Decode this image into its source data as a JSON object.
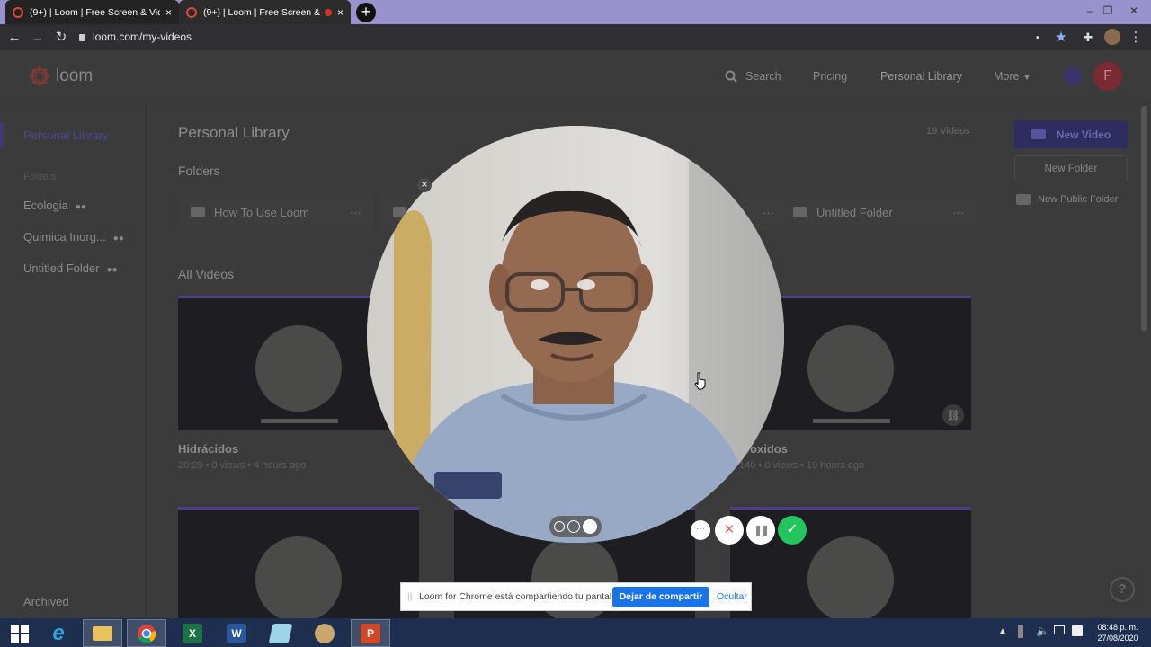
{
  "browser": {
    "tabs": [
      {
        "title": "(9+) | Loom | Free Screen & Vide",
        "close": "×"
      },
      {
        "title": "(9+) | Loom | Free Screen & \\",
        "close": "×"
      }
    ],
    "new_tab": "+",
    "url": "loom.com/my-videos",
    "window_controls": {
      "minimize": "–",
      "restore": "❐",
      "close": "✕"
    }
  },
  "app": {
    "logo_text": "loom",
    "nav": {
      "search": "Search",
      "pricing": "Pricing",
      "personal_library": "Personal Library",
      "more": "More",
      "avatar_letter": "F"
    },
    "sidebar": {
      "active": "Personal Library",
      "folders_heading": "Folders",
      "items": [
        {
          "label": "Ecologia"
        },
        {
          "label": "Quimica Inorg..."
        },
        {
          "label": "Untitled Folder"
        }
      ],
      "archived": "Archived"
    },
    "main": {
      "title": "Personal Library",
      "video_count": "19 Videos",
      "folders_heading": "Folders",
      "folders": [
        {
          "name": "How To Use Loom",
          "menu": "···"
        },
        {
          "name": "Untitled Folder",
          "menu": "···"
        }
      ],
      "all_videos_heading": "All Videos",
      "videos": [
        {
          "title": "Hidrácidos",
          "meta": "20:29 • 0 views • 4 hours ago"
        },
        {
          "title": "roxidos",
          "meta": "140 • 0 views • 19 hours ago"
        }
      ]
    },
    "actions": {
      "new_video": "New Video",
      "new_folder": "New Folder",
      "new_public_folder": "New Public Folder"
    },
    "help": "?"
  },
  "recorder": {
    "close": "×",
    "more": "···",
    "cancel": "✕",
    "pause": "❚❚",
    "done": "✓"
  },
  "share_banner": {
    "handle": "||",
    "message": "Loom for Chrome está compartiendo tu pantalla.",
    "stop_button": "Dejar de compartir",
    "hide_link": "Ocultar"
  },
  "taskbar": {
    "time": "08:48 p. m.",
    "date": "27/08/2020",
    "apps": [
      "windows-start",
      "internet-explorer",
      "file-explorer",
      "chrome",
      "excel",
      "word",
      "notes",
      "paint",
      "powerpoint"
    ]
  },
  "colors": {
    "tab_strip": "#9a92cc",
    "loom_accent": "#625df5",
    "share_button": "#1a73e8",
    "done_button": "#22c55e"
  }
}
